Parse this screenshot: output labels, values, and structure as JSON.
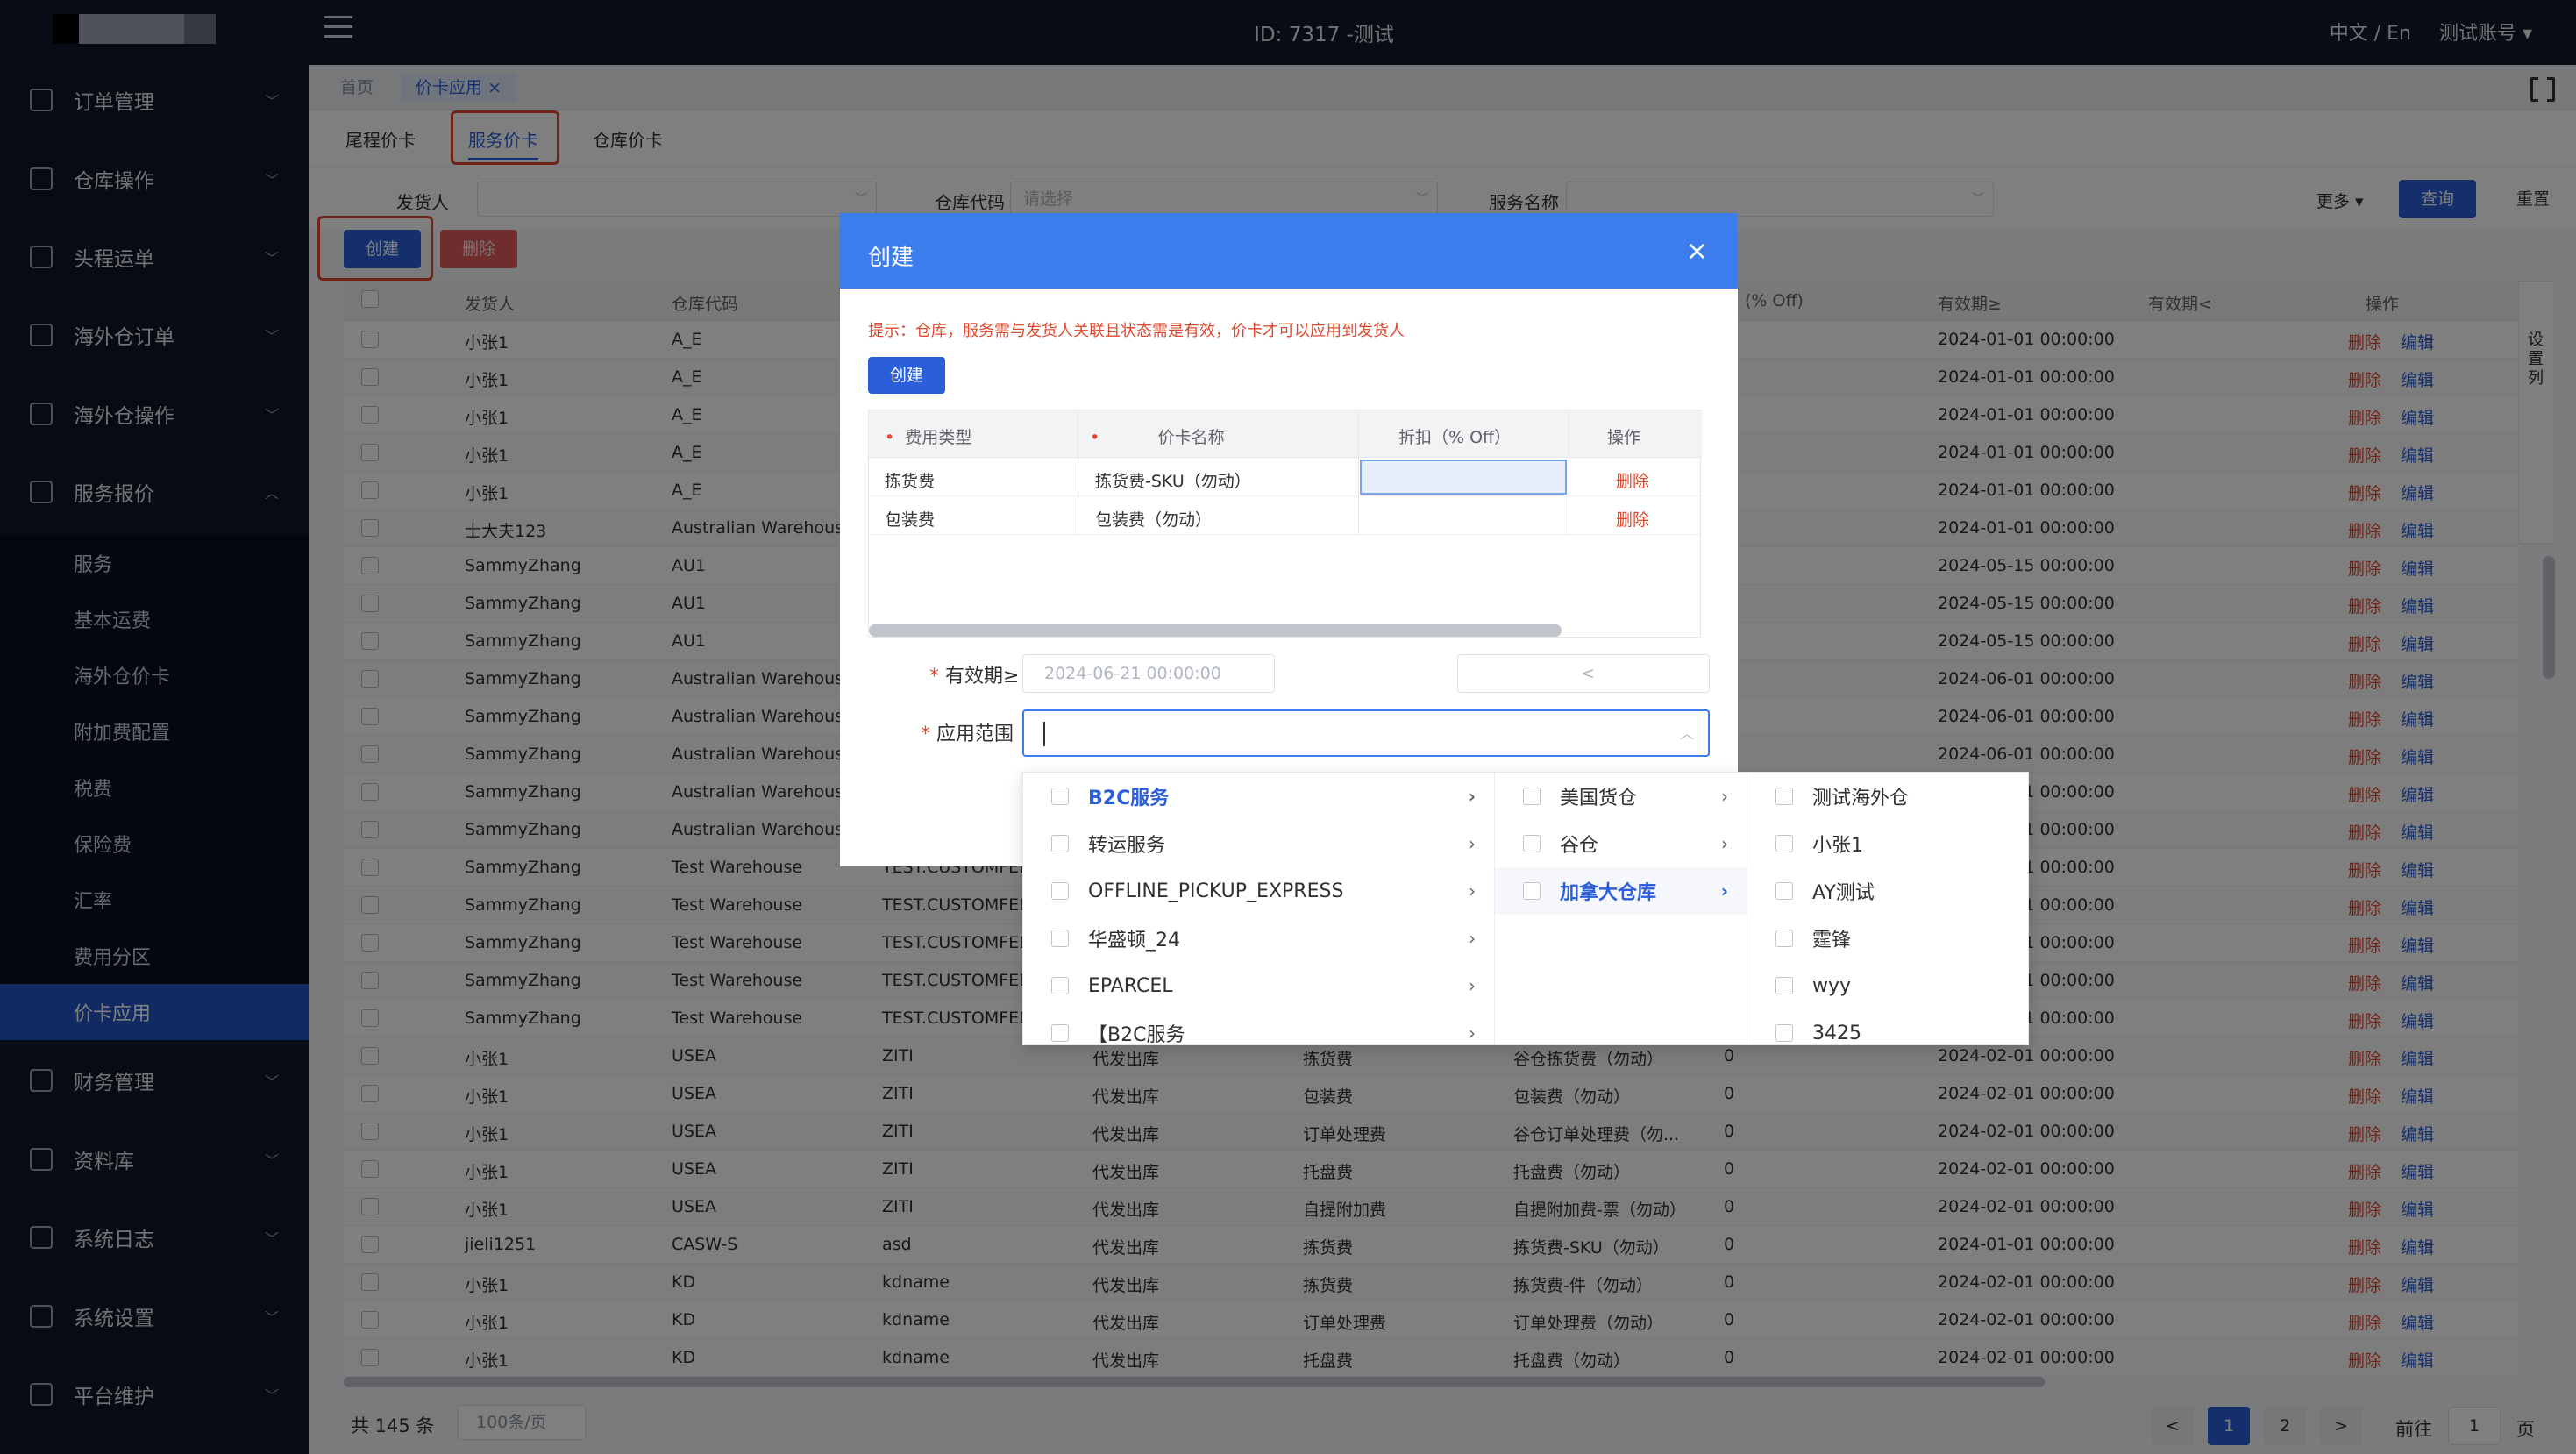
{
  "header": {
    "title": "ID: 7317 -测试",
    "lang": "中文 / En",
    "account": "测试账号 ▾"
  },
  "sidebar": {
    "top_items": [
      {
        "label": "订单管理",
        "icon": "order-icon"
      },
      {
        "label": "仓库操作",
        "icon": "warehouse-icon"
      },
      {
        "label": "头程运单",
        "icon": "shipment-icon"
      },
      {
        "label": "海外仓订单",
        "icon": "overseas-order-icon"
      },
      {
        "label": "海外仓操作",
        "icon": "overseas-ops-icon"
      },
      {
        "label": "服务报价",
        "icon": "quote-icon"
      }
    ],
    "sub_items": [
      "服务",
      "基本运费",
      "海外仓价卡",
      "附加费配置",
      "税费",
      "保险费",
      "汇率",
      "费用分区",
      "价卡应用"
    ],
    "bottom_items": [
      {
        "label": "财务管理",
        "icon": "finance-icon"
      },
      {
        "label": "资料库",
        "icon": "library-icon"
      },
      {
        "label": "系统日志",
        "icon": "log-icon"
      },
      {
        "label": "系统设置",
        "icon": "settings-icon"
      },
      {
        "label": "平台维护",
        "icon": "platform-icon"
      }
    ]
  },
  "tags": {
    "home": "首页",
    "current": "价卡应用",
    "close": "×"
  },
  "subtabs": [
    "尾程价卡",
    "服务价卡",
    "仓库价卡"
  ],
  "filters": {
    "shipper_label": "发货人",
    "warehouse_label": "仓库代码",
    "warehouse_placeholder": "请选择",
    "service_label": "服务名称",
    "more": "更多 ▾",
    "query": "查询",
    "reset": "重置"
  },
  "actions": {
    "create": "创建",
    "delete": "删除"
  },
  "table": {
    "headers": [
      "发货人",
      "仓库代码",
      "(% Off)",
      "有效期≥",
      "有效期<",
      "操作"
    ],
    "row_actions": {
      "delete": "删除",
      "edit": "编辑"
    },
    "settings": "设置列",
    "rows": [
      [
        "小张1",
        "A_E",
        "",
        "",
        "",
        "",
        "",
        "",
        "2024-01-01 00:00:00"
      ],
      [
        "小张1",
        "A_E",
        "",
        "",
        "",
        "",
        "",
        "",
        "2024-01-01 00:00:00"
      ],
      [
        "小张1",
        "A_E",
        "",
        "",
        "",
        "",
        "",
        "",
        "2024-01-01 00:00:00"
      ],
      [
        "小张1",
        "A_E",
        "",
        "",
        "",
        "",
        "",
        "",
        "2024-01-01 00:00:00"
      ],
      [
        "小张1",
        "A_E",
        "",
        "",
        "",
        "",
        "",
        "",
        "2024-01-01 00:00:00"
      ],
      [
        "士大夫123",
        "Australian Warehouse",
        "",
        "",
        "",
        "",
        "",
        "",
        "2024-01-01 00:00:00"
      ],
      [
        "SammyZhang",
        "AU1",
        "",
        "",
        "",
        "",
        "",
        "",
        "2024-05-15 00:00:00"
      ],
      [
        "SammyZhang",
        "AU1",
        "",
        "",
        "",
        "",
        "",
        "",
        "2024-05-15 00:00:00"
      ],
      [
        "SammyZhang",
        "AU1",
        "",
        "",
        "",
        "",
        "",
        "",
        "2024-05-15 00:00:00"
      ],
      [
        "SammyZhang",
        "Australian Warehouse",
        "",
        "",
        "",
        "",
        "",
        "",
        "2024-06-01 00:00:00"
      ],
      [
        "SammyZhang",
        "Australian Warehouse",
        "",
        "",
        "",
        "",
        "",
        "",
        "2024-06-01 00:00:00"
      ],
      [
        "SammyZhang",
        "Australian Warehouse",
        "",
        "",
        "",
        "",
        "",
        "",
        "2024-06-01 00:00:00"
      ],
      [
        "SammyZhang",
        "Australian Warehouse",
        "",
        "",
        "",
        "",
        "",
        "",
        "2024-06-01 00:00:00"
      ],
      [
        "SammyZhang",
        "Australian Warehouse",
        "",
        "",
        "",
        "",
        "",
        "",
        "2024-06-01 00:00:00"
      ],
      [
        "SammyZhang",
        "Test Warehouse",
        "TEST.CUSTOMFEE",
        "",
        "",
        "",
        "",
        "",
        "2024-06-01 00:00:00"
      ],
      [
        "SammyZhang",
        "Test Warehouse",
        "TEST.CUSTOMFEE",
        "",
        "",
        "",
        "",
        "",
        "2024-06-01 00:00:00"
      ],
      [
        "SammyZhang",
        "Test Warehouse",
        "TEST.CUSTOMFEE",
        "",
        "",
        "",
        "",
        "",
        "2024-06-01 00:00:00"
      ],
      [
        "SammyZhang",
        "Test Warehouse",
        "TEST.CUSTOMFEE",
        "",
        "",
        "",
        "",
        "",
        "2024-06-01 00:00:00"
      ],
      [
        "SammyZhang",
        "Test Warehouse",
        "TEST.CUSTOMFEE",
        "",
        "",
        "",
        "",
        "",
        "2024-06-01 00:00:00"
      ],
      [
        "小张1",
        "USEA",
        "ZITI",
        "代发出库",
        "拣货费",
        "谷仓拣货费（勿动）",
        "0",
        "",
        "2024-02-01 00:00:00"
      ],
      [
        "小张1",
        "USEA",
        "ZITI",
        "代发出库",
        "包装费",
        "包装费（勿动）",
        "0",
        "",
        "2024-02-01 00:00:00"
      ],
      [
        "小张1",
        "USEA",
        "ZITI",
        "代发出库",
        "订单处理费",
        "谷仓订单处理费（勿...",
        "0",
        "",
        "2024-02-01 00:00:00"
      ],
      [
        "小张1",
        "USEA",
        "ZITI",
        "代发出库",
        "托盘费",
        "托盘费（勿动）",
        "0",
        "",
        "2024-02-01 00:00:00"
      ],
      [
        "小张1",
        "USEA",
        "ZITI",
        "代发出库",
        "自提附加费",
        "自提附加费-票（勿动）",
        "0",
        "",
        "2024-02-01 00:00:00"
      ],
      [
        "jieli1251",
        "CASW-S",
        "asd",
        "代发出库",
        "拣货费",
        "拣货费-SKU（勿动）",
        "0",
        "",
        "2024-01-01 00:00:00"
      ],
      [
        "小张1",
        "KD",
        "kdname",
        "代发出库",
        "拣货费",
        "拣货费-件（勿动）",
        "0",
        "",
        "2024-02-01 00:00:00"
      ],
      [
        "小张1",
        "KD",
        "kdname",
        "代发出库",
        "订单处理费",
        "订单处理费（勿动）",
        "0",
        "",
        "2024-02-01 00:00:00"
      ],
      [
        "小张1",
        "KD",
        "kdname",
        "代发出库",
        "托盘费",
        "托盘费（勿动）",
        "0",
        "",
        "2024-02-01 00:00:00"
      ]
    ]
  },
  "pagination": {
    "total": "共 145 条",
    "page_size": "100条/页",
    "pages": [
      "1",
      "2"
    ],
    "prev": "<",
    "next": ">",
    "goto": "前往",
    "goto_value": "1",
    "page_unit": "页"
  },
  "modal": {
    "title": "创建",
    "close": "×",
    "tip": "提示：仓库，服务需与发货人关联且状态需是有效，价卡才可以应用到发货人",
    "create": "创建",
    "inner_headers": [
      "费用类型",
      "价卡名称",
      "折扣（% Off）",
      "操作"
    ],
    "inner_rows": [
      {
        "fee_type": "拣货费",
        "card": "拣货费-SKU（勿动）",
        "discount": "",
        "action": "删除"
      },
      {
        "fee_type": "包装费",
        "card": "包装费（勿动）",
        "discount": "",
        "action": "删除"
      }
    ],
    "valid_from_label": "有效期≥",
    "valid_from_value": "2024-06-21 00:00:00",
    "valid_to_sep": "<",
    "scope_label": "应用范围"
  },
  "cascader": {
    "col1": [
      {
        "label": "B2C服务",
        "selected": true
      },
      {
        "label": "转运服务"
      },
      {
        "label": "OFFLINE_PICKUP_EXPRESS"
      },
      {
        "label": "华盛顿_24"
      },
      {
        "label": "EPARCEL"
      },
      {
        "label": "【B2C服务"
      }
    ],
    "col2": [
      {
        "label": "美国货仓"
      },
      {
        "label": "谷仓"
      },
      {
        "label": "加拿大仓库",
        "selected": true
      }
    ],
    "col3": [
      "测试海外仓",
      "小张1",
      "AY测试",
      "霆锋",
      "wyy",
      "3425"
    ]
  },
  "colors": {
    "primary": "#2b5fd9",
    "danger": "#e0492e",
    "header_bg": "#111a2b",
    "modal_head": "#3b7ded"
  }
}
